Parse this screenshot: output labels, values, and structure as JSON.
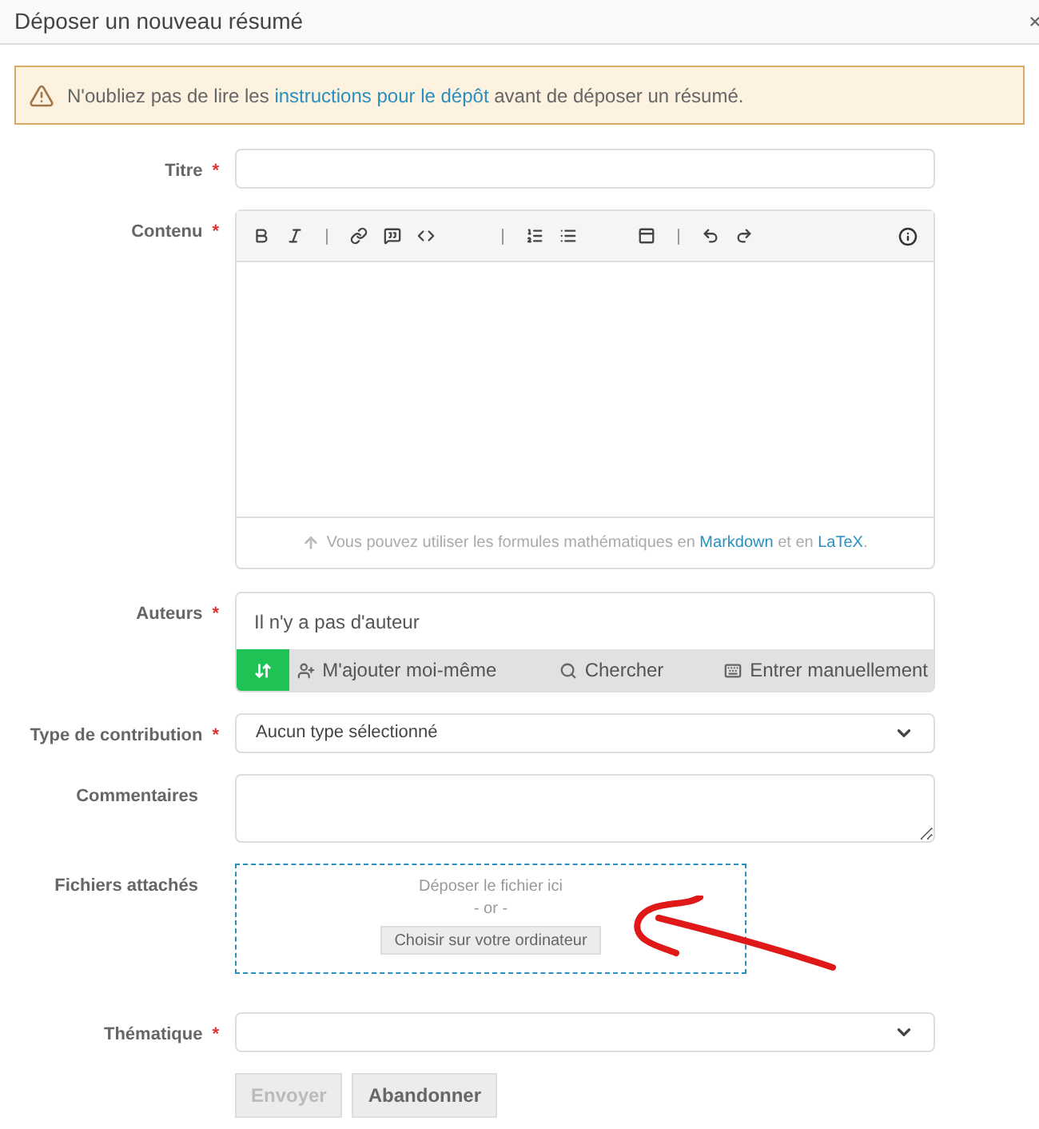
{
  "window": {
    "title": "Déposer un nouveau résumé"
  },
  "alert": {
    "before": "N'oubliez pas de lire les ",
    "link": "instructions pour le dépôt",
    "after": " avant de déposer un résumé."
  },
  "fields": [
    {
      "kind": "text",
      "label": "Titre",
      "required_mark": "*"
    },
    {
      "kind": "editor",
      "label": "Contenu",
      "required_mark": "*",
      "hint_before": "Vous pouvez utiliser les formules mathématiques en ",
      "link1": "Markdown",
      "hint_middle": " et en ",
      "link2": "LaTeX",
      "hint_after": "."
    },
    {
      "kind": "authors",
      "label": "Auteurs",
      "required_mark": "*",
      "empty_text": "Il n'y a pas d'auteur",
      "actions": [
        "M'ajouter moi-même",
        "Chercher",
        "Entrer manuellement"
      ]
    },
    {
      "kind": "select",
      "label": "Type de contribution",
      "required_mark": "*",
      "value": "Aucun type sélectionné"
    },
    {
      "kind": "textarea",
      "label": "Commentaires"
    },
    {
      "kind": "dropzone",
      "label": "Fichiers attachés",
      "drop_text": "Déposer le fichier ici",
      "or_text": "- or -",
      "button": "Choisir sur votre ordinateur"
    },
    {
      "kind": "select",
      "label": "Thématique",
      "required_mark": "*"
    }
  ],
  "buttons": [
    {
      "label": "Envoyer",
      "disabled": true
    },
    {
      "label": "Abandonner",
      "disabled": false
    }
  ],
  "annotation": {
    "kind": "arrow"
  }
}
